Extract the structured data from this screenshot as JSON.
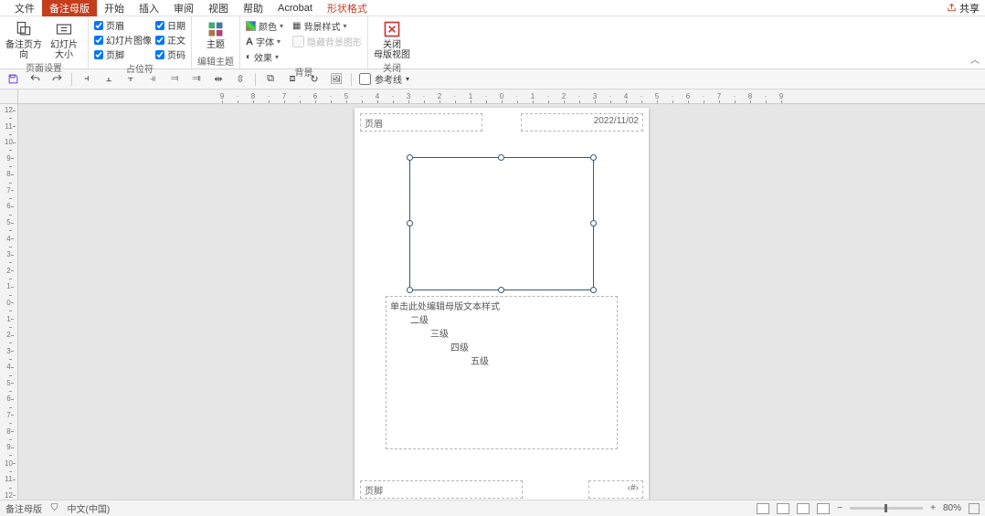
{
  "menu": {
    "tabs": [
      "文件",
      "备注母版",
      "开始",
      "插入",
      "审阅",
      "视图",
      "帮助",
      "Acrobat",
      "形状格式"
    ],
    "activeIndex": 1,
    "contextIndex": 8,
    "share": "共享"
  },
  "ribbon": {
    "groups": {
      "pageSetup": {
        "label": "页面设置",
        "orientation": "备注页方向",
        "slideSize": "幻灯片\n大小"
      },
      "placeholders": {
        "label": "占位符",
        "header": "页眉",
        "slideImage": "幻灯片图像",
        "footer": "页脚",
        "date": "日期",
        "body": "正文",
        "pageNum": "页码"
      },
      "editTheme": {
        "label": "编辑主题",
        "themes": "主题"
      },
      "background": {
        "label": "背景",
        "colors": "颜色",
        "fonts": "字体",
        "effects": "效果",
        "bgStyle": "背景样式",
        "hideBg": "隐藏背景图形"
      },
      "close": {
        "label": "关闭",
        "btn": "关闭\n母版视图"
      }
    },
    "guides_label": "参考线"
  },
  "canvas": {
    "header": "页眉",
    "date": "2022/11/02",
    "footer": "页脚",
    "pageNum": "‹#›",
    "body": {
      "l1": "单击此处编辑母版文本样式",
      "l2": "二级",
      "l3": "三级",
      "l4": "四级",
      "l5": "五级"
    },
    "hruler": [
      "9",
      "·",
      "8",
      "·",
      "7",
      "·",
      "6",
      "·",
      "5",
      "·",
      "4",
      "·",
      "3",
      "·",
      "2",
      "·",
      "1",
      "·",
      "0",
      "·",
      "1",
      "·",
      "2",
      "·",
      "3",
      "·",
      "4",
      "·",
      "5",
      "·",
      "6",
      "·",
      "7",
      "·",
      "8",
      "·",
      "9"
    ],
    "vruler": [
      "12",
      "",
      "11",
      "",
      "10",
      "",
      "9",
      "",
      "8",
      "",
      "7",
      "",
      "6",
      "",
      "5",
      "",
      "4",
      "",
      "3",
      "",
      "2",
      "",
      "1",
      "",
      "0",
      "",
      "1",
      "",
      "2",
      "",
      "3",
      "",
      "4",
      "",
      "5",
      "",
      "6",
      "",
      "7",
      "",
      "8",
      "",
      "9",
      "",
      "10",
      "",
      "11",
      "",
      "12"
    ]
  },
  "status": {
    "mode": "备注母版",
    "lang": "中文(中国)",
    "zoom": "80%"
  }
}
